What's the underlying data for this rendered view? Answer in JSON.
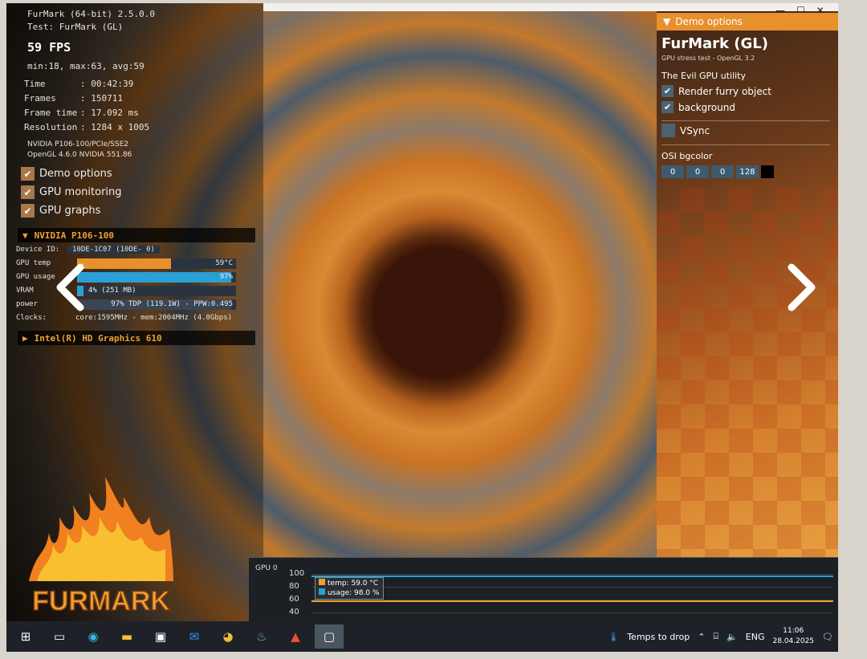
{
  "osd": {
    "title_line1": "FurMark (64-bit) 2.5.0.0",
    "title_line2": "Test: FurMark (GL)",
    "fps": "59 FPS",
    "minmax": "min:18, max:63, avg:59",
    "stats": [
      {
        "key": "Time",
        "value": ": 00:42:39"
      },
      {
        "key": "Frames",
        "value": ": 150711"
      },
      {
        "key": "Frame time",
        "value": ": 17.092 ms"
      },
      {
        "key": "Resolution",
        "value": ": 1284 x 1005"
      }
    ],
    "gpu_line1": "NVIDIA P106-100/PCIe/SSE2",
    "gpu_line2": "OpenGL 4.6.0 NVIDIA 551.86"
  },
  "toggles": [
    {
      "label": "Demo options",
      "checked": true
    },
    {
      "label": "GPU monitoring",
      "checked": true
    },
    {
      "label": "GPU graphs",
      "checked": true
    }
  ],
  "gpu_section": {
    "name": "NVIDIA P106-100",
    "device_id_label": "Device ID:",
    "device_id_value": "10DE-1C07 (10DE-   0)",
    "temp_label": "GPU temp",
    "temp_value": "59°C",
    "temp_fraction": 0.59,
    "usage_label": "GPU usage",
    "usage_value": "97%",
    "usage_fraction": 0.97,
    "vram_label": "VRAM",
    "vram_value": "4% (251 MB)",
    "vram_fraction": 0.04,
    "power_label": "power",
    "power_value": "97% TDP (119.1W) - PPW:0.495",
    "power_fraction": 0.97,
    "clocks_label": "Clocks:",
    "clocks_value": "core:1595MHz - mem:2004MHz (4.0Gbps)"
  },
  "igpu_section": {
    "name": "Intel(R) HD Graphics 610"
  },
  "demo_options": {
    "header": "Demo options",
    "title": "FurMark (GL)",
    "subtitle": "GPU stress test - OpenGL 3.2",
    "tagline": "The Evil GPU utility",
    "options": [
      {
        "label": "Render furry object",
        "checked": true
      },
      {
        "label": "background",
        "checked": true
      }
    ],
    "vsync": {
      "label": "VSync",
      "checked": false
    },
    "osi_label": "OSI bgcolor",
    "osi_values": [
      "0",
      "0",
      "0",
      "128"
    ]
  },
  "graph": {
    "label": "GPU 0",
    "y_ticks": [
      "100",
      "80",
      "60",
      "40"
    ],
    "legend": [
      {
        "label": "temp: 59.0 °C",
        "color": "#f0a030"
      },
      {
        "label": "usage: 98.0 %",
        "color": "#2a9fd6"
      }
    ]
  },
  "logo_text": "FURMARK",
  "taskbar": {
    "weather": "Temps to drop",
    "lang": "ENG",
    "time": "11:06",
    "date": "28.04.2025"
  },
  "colors": {
    "accent": "#e8902c",
    "usage": "#2a9fd6",
    "temp": "#f0a030"
  }
}
